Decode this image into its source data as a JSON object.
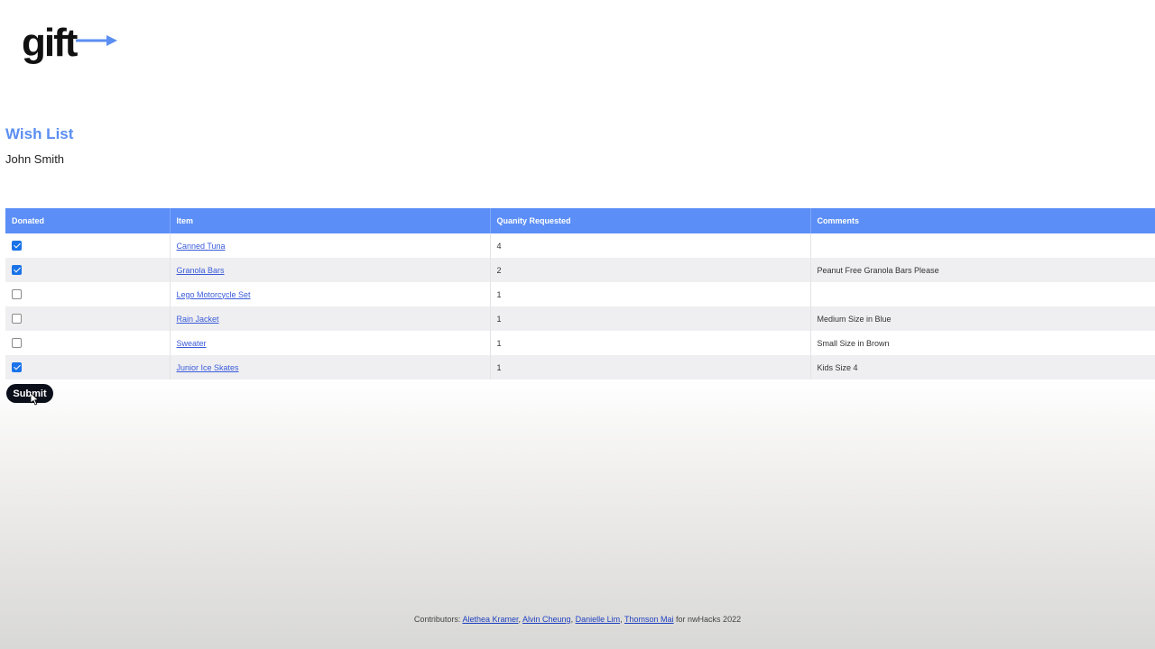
{
  "logo": {
    "text": "gift",
    "arrow_color": "#5b8ef2"
  },
  "page": {
    "title": "Wish List",
    "person": "John Smith"
  },
  "table": {
    "headers": [
      "Donated",
      "Item",
      "Quanity Requested",
      "Comments"
    ],
    "rows": [
      {
        "donated": true,
        "item": "Canned Tuna",
        "quantity": "4",
        "comment": ""
      },
      {
        "donated": true,
        "item": "Granola Bars",
        "quantity": "2",
        "comment": "Peanut Free Granola Bars Please"
      },
      {
        "donated": false,
        "item": "Lego Motorcycle Set",
        "quantity": "1",
        "comment": ""
      },
      {
        "donated": false,
        "item": "Rain Jacket",
        "quantity": "1",
        "comment": "Medium Size in Blue"
      },
      {
        "donated": false,
        "item": "Sweater",
        "quantity": "1",
        "comment": "Small Size in Brown"
      },
      {
        "donated": true,
        "item": "Junior Ice Skates",
        "quantity": "1",
        "comment": "Kids Size 4"
      }
    ]
  },
  "submit": {
    "label": "Submit"
  },
  "footer": {
    "prefix": "Contributors:",
    "contributors": [
      "Alethea Kramer",
      "Alvin Cheung",
      "Danielle Lim",
      "Thomson Mai"
    ],
    "separator": ",",
    "suffix": "for nwHacks 2022"
  },
  "colors": {
    "header_bg": "#5b8ef7",
    "title": "#5b8ef2",
    "button_bg": "#0b0f1a",
    "link": "#3b5bdb"
  }
}
